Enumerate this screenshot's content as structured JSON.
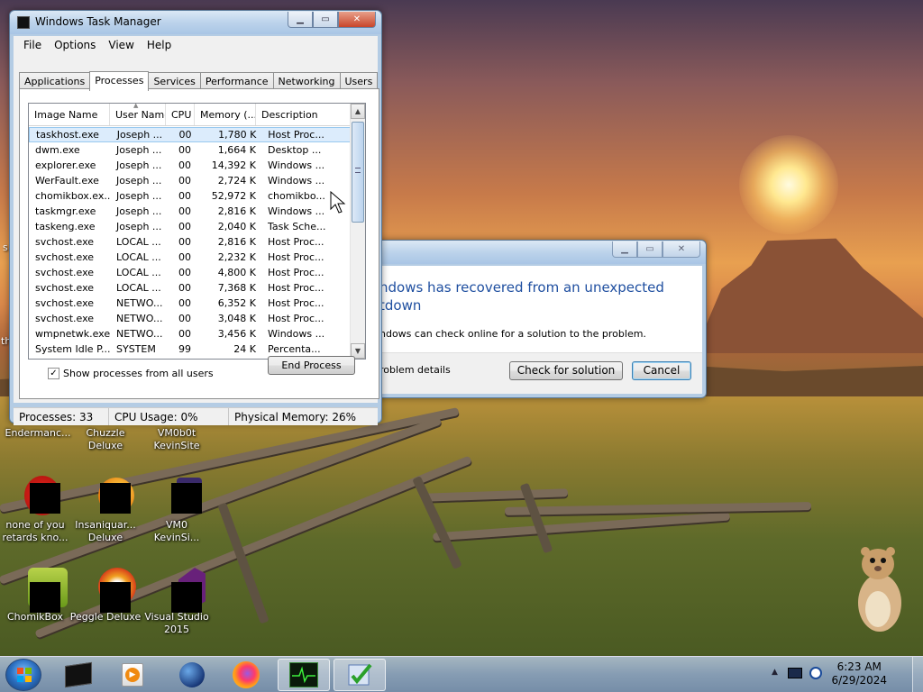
{
  "taskmgr": {
    "title": "Windows Task Manager",
    "menu": [
      "File",
      "Options",
      "View",
      "Help"
    ],
    "tabs": [
      "Applications",
      "Processes",
      "Services",
      "Performance",
      "Networking",
      "Users"
    ],
    "active_tab": "Processes",
    "columns": [
      "Image Name",
      "User Name",
      "CPU",
      "Memory (...",
      "Description"
    ],
    "rows": [
      [
        "taskhost.exe",
        "Joseph ...",
        "00",
        "1,780 K",
        "Host Proc..."
      ],
      [
        "dwm.exe",
        "Joseph ...",
        "00",
        "1,664 K",
        "Desktop ..."
      ],
      [
        "explorer.exe",
        "Joseph ...",
        "00",
        "14,392 K",
        "Windows ..."
      ],
      [
        "WerFault.exe",
        "Joseph ...",
        "00",
        "2,724 K",
        "Windows ..."
      ],
      [
        "chomikbox.ex...",
        "Joseph ...",
        "00",
        "52,972 K",
        "chomikbo..."
      ],
      [
        "taskmgr.exe",
        "Joseph ...",
        "00",
        "2,816 K",
        "Windows ..."
      ],
      [
        "taskeng.exe",
        "Joseph ...",
        "00",
        "2,040 K",
        "Task Sche..."
      ],
      [
        "svchost.exe",
        "LOCAL ...",
        "00",
        "2,816 K",
        "Host Proc..."
      ],
      [
        "svchost.exe",
        "LOCAL ...",
        "00",
        "2,232 K",
        "Host Proc..."
      ],
      [
        "svchost.exe",
        "LOCAL ...",
        "00",
        "4,800 K",
        "Host Proc..."
      ],
      [
        "svchost.exe",
        "LOCAL ...",
        "00",
        "7,368 K",
        "Host Proc..."
      ],
      [
        "svchost.exe",
        "NETWO...",
        "00",
        "6,352 K",
        "Host Proc..."
      ],
      [
        "svchost.exe",
        "NETWO...",
        "00",
        "3,048 K",
        "Host Proc..."
      ],
      [
        "wmpnetwk.exe",
        "NETWO...",
        "00",
        "3,456 K",
        "Windows ..."
      ],
      [
        "System Idle P...",
        "SYSTEM",
        "99",
        "24 K",
        "Percenta..."
      ]
    ],
    "show_all_label": "Show processes from all users",
    "show_all_checked": true,
    "end_process_label": "End Process",
    "status": {
      "processes": "Processes: 33",
      "cpu": "CPU Usage: 0%",
      "memory": "Physical Memory: 26%"
    }
  },
  "wer_dialog": {
    "heading_line1": "ndows has recovered from an unexpected",
    "heading_line2": "tdown",
    "body": "ndows can check online for a solution to the problem.",
    "details_label": "roblem details",
    "check_button": "Check for solution",
    "cancel_button": "Cancel"
  },
  "desktop_icons": [
    {
      "line1": "Endermanc...",
      "line2": ""
    },
    {
      "line1": "Chuzzle",
      "line2": "Deluxe"
    },
    {
      "line1": "VM0b0t",
      "line2": "KevinSite"
    },
    {
      "line1": "none of you",
      "line2": "retards kno..."
    },
    {
      "line1": "Insaniquar...",
      "line2": "Deluxe"
    },
    {
      "line1": "VM0",
      "line2": "KevinSi..."
    },
    {
      "line1": "ChomikBox",
      "line2": ""
    },
    {
      "line1": "Peggle Deluxe",
      "line2": ""
    },
    {
      "line1": "Visual Studio",
      "line2": "2015"
    }
  ],
  "edge_text": {
    "s": "s",
    "th": "th"
  },
  "taskbar": {
    "pinned": [
      "cmd-icon",
      "media-player-icon",
      "globe-icon",
      "firefox-icon",
      "task-manager-icon",
      "checklist-icon"
    ],
    "time": "6:23 AM",
    "date": "6/29/2024"
  },
  "colors": {
    "selection": "#dcecfc",
    "link_blue": "#1f4fa0",
    "close_red": "#c8452a"
  }
}
